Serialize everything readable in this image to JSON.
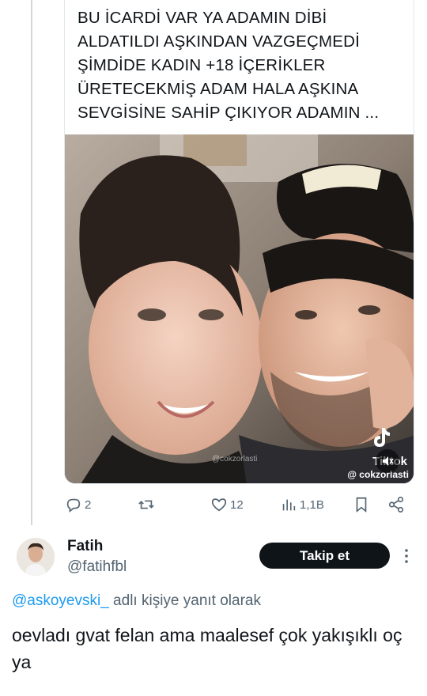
{
  "quoted_tweet": {
    "text": "BU İCARDİ VAR YA ADAMIN DİBİ ALDATILDI AŞKINDAN VAZGEÇMEDİ ŞİMDİDE KADIN +18 İÇERİKLER ÜRETECEKMİŞ ADAM HALA AŞKINA SEVGİSİNE SAHİP ÇIKIYOR ADAMIN ...",
    "media": {
      "type": "video",
      "platform_logo": "tiktok-logo",
      "platform_word": "Tiktok",
      "tiktok_handle": "@ cokzorlasti",
      "watermark": "@cokzorlasti"
    },
    "actions": {
      "replies": "2",
      "retweets": "",
      "likes": "12",
      "views": "1,1B"
    }
  },
  "reply": {
    "author_name": "Fatih",
    "author_handle": "@fatihfbl",
    "follow_label": "Takip et",
    "reply_to_mention": "@askoyevski_",
    "reply_to_suffix": " adlı kişiye yanıt olarak",
    "text": "oevladı gvat felan ama maalesef çok yakışıklı oç ya"
  },
  "colors": {
    "text": "#0f1419",
    "secondary": "#536471",
    "link": "#1d9bf0",
    "border": "#e1e8ed",
    "button_bg": "#0f1419"
  }
}
